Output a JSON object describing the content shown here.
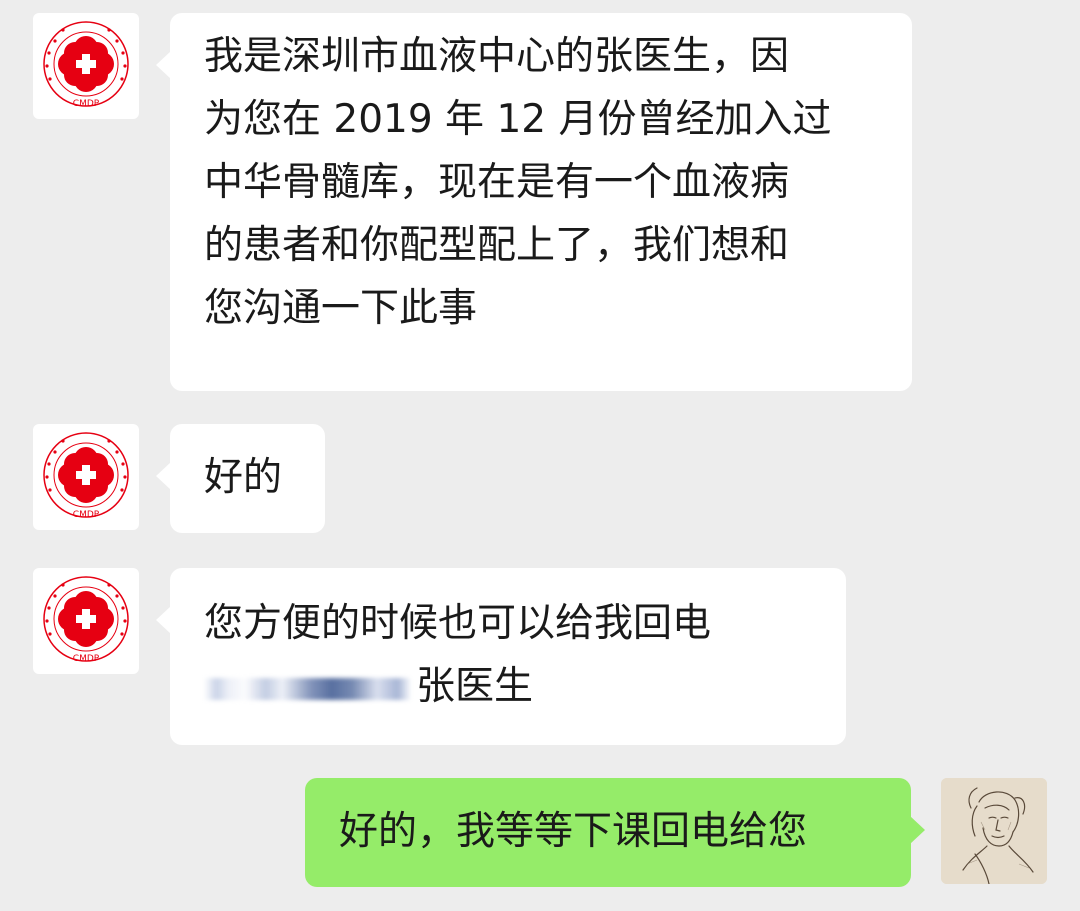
{
  "contact": {
    "avatar_icon": "cmdp-logo-icon",
    "avatar_text": "CMDP"
  },
  "self": {
    "avatar_icon": "sketch-portrait-avatar-icon"
  },
  "messages": [
    {
      "from": "contact",
      "lines": [
        "我是深圳市血液中心的张医生，因",
        "为您在 2019 年 12 月份曾经加入过",
        "中华骨髓库，现在是有一个血液病",
        "的患者和你配型配上了，我们想和",
        "您沟通一下此事"
      ]
    },
    {
      "from": "contact",
      "lines": [
        "好的"
      ]
    },
    {
      "from": "contact",
      "lines": [
        "您方便的时候也可以给我回电"
      ],
      "redacted_phone_icon": "blurred-phone-number",
      "tail_text": "张医生"
    },
    {
      "from": "self",
      "lines": [
        "好的，我等等下课回电给您"
      ]
    }
  ],
  "colors": {
    "background": "#ededed",
    "incoming_bubble": "#ffffff",
    "outgoing_bubble": "#95ec69",
    "logo_red": "#e60012"
  }
}
